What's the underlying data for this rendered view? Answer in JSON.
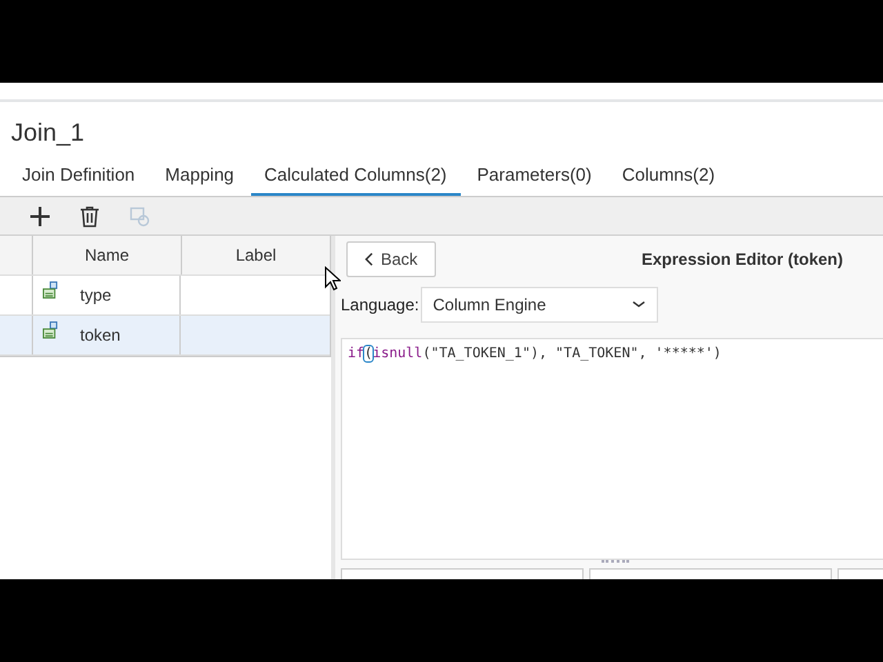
{
  "title": "Join_1",
  "tabs": [
    {
      "label": "Join Definition",
      "selected": false
    },
    {
      "label": "Mapping",
      "selected": false
    },
    {
      "label": "Calculated Columns(2)",
      "selected": true
    },
    {
      "label": "Parameters(0)",
      "selected": false
    },
    {
      "label": "Columns(2)",
      "selected": false
    }
  ],
  "toolbar": [
    {
      "kind": "add",
      "disabled": false
    },
    {
      "kind": "delete",
      "disabled": false
    },
    {
      "kind": "convert",
      "disabled": true
    }
  ],
  "table": {
    "columns": [
      "Name",
      "Label"
    ],
    "rows": [
      {
        "name": "type",
        "label": "",
        "selected": false
      },
      {
        "name": "token",
        "label": "",
        "selected": true
      }
    ]
  },
  "editor": {
    "back": "Back",
    "title": "Expression Editor (token)",
    "language_label": "Language:",
    "language": "Column Engine",
    "code": [
      {
        "text": "if",
        "kind": "keyword"
      },
      {
        "text": "(",
        "kind": "cursor"
      },
      {
        "text": "isnull",
        "kind": "keyword"
      },
      {
        "text": "(\"TA_TOKEN_1\"), \"TA_TOKEN\", '*****')",
        "kind": "plain"
      }
    ]
  }
}
